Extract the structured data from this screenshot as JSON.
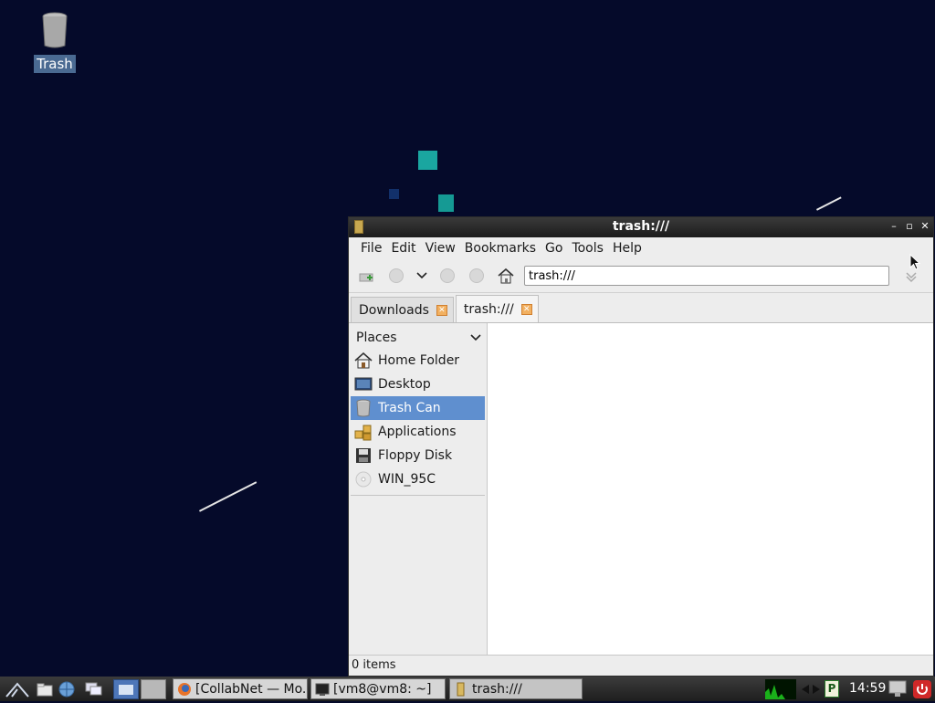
{
  "desktop": {
    "trash_label": "Trash"
  },
  "window": {
    "title": "trash:///",
    "menu": [
      "File",
      "Edit",
      "View",
      "Bookmarks",
      "Go",
      "Tools",
      "Help"
    ],
    "address": "trash:///",
    "tabs": [
      {
        "label": "Downloads",
        "active": false
      },
      {
        "label": "trash:///",
        "active": true
      }
    ],
    "sidebar": {
      "header": "Places",
      "items": [
        {
          "label": "Home Folder",
          "icon": "home-icon",
          "selected": false
        },
        {
          "label": "Desktop",
          "icon": "desktop-icon",
          "selected": false
        },
        {
          "label": "Trash Can",
          "icon": "trash-icon",
          "selected": true
        },
        {
          "label": "Applications",
          "icon": "applications-icon",
          "selected": false
        },
        {
          "label": "Floppy Disk",
          "icon": "floppy-disk-icon",
          "selected": false
        },
        {
          "label": "WIN_95C",
          "icon": "cdrom-icon",
          "selected": false
        }
      ]
    },
    "status": "0 items"
  },
  "taskbar": {
    "tasks": [
      {
        "label": "[CollabNet — Mo...",
        "icon": "firefox-icon"
      },
      {
        "label": "[vm8@vm8: ~]",
        "icon": "terminal-icon"
      },
      {
        "label": "trash:///",
        "icon": "folder-icon"
      }
    ],
    "clock": "14:59"
  },
  "colors": {
    "desktop_bg": "#050a2a",
    "selection": "#5f8fcf",
    "tab_close": "#f2b060"
  }
}
